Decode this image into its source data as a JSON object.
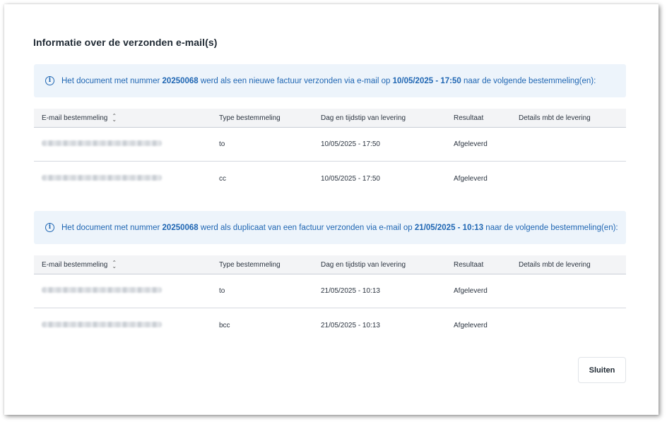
{
  "dialog": {
    "title": "Informatie over de verzonden e-mail(s)",
    "close_label": "Sluiten"
  },
  "columns": {
    "email": "E-mail bestemmeling",
    "type": "Type bestemmeling",
    "date": "Dag en tijdstip van levering",
    "result": "Resultaat",
    "details": "Details mbt de levering"
  },
  "sections": [
    {
      "info": {
        "prefix": "Het document met nummer ",
        "number": "20250068",
        "middle": " werd als een nieuwe factuur verzonden via e-mail op ",
        "datetime": "10/05/2025 - 17:50",
        "suffix": " naar de volgende bestemmeling(en):"
      },
      "rows": [
        {
          "type": "to",
          "date": "10/05/2025 - 17:50",
          "result": "Afgeleverd",
          "details": ""
        },
        {
          "type": "cc",
          "date": "10/05/2025 - 17:50",
          "result": "Afgeleverd",
          "details": ""
        }
      ]
    },
    {
      "info": {
        "prefix": "Het document met nummer ",
        "number": "20250068",
        "middle": " werd als duplicaat van een factuur verzonden via e-mail op ",
        "datetime": "21/05/2025 - 10:13",
        "suffix": " naar de volgende bestemmeling(en):"
      },
      "rows": [
        {
          "type": "to",
          "date": "21/05/2025 - 10:13",
          "result": "Afgeleverd",
          "details": ""
        },
        {
          "type": "bcc",
          "date": "21/05/2025 - 10:13",
          "result": "Afgeleverd",
          "details": ""
        }
      ]
    }
  ],
  "icons": {
    "info": "info-icon",
    "sort": "sort-icon"
  },
  "colors": {
    "accent": "#1f66b3",
    "info_background": "#edf4fb",
    "header_background": "#f3f4f6"
  }
}
